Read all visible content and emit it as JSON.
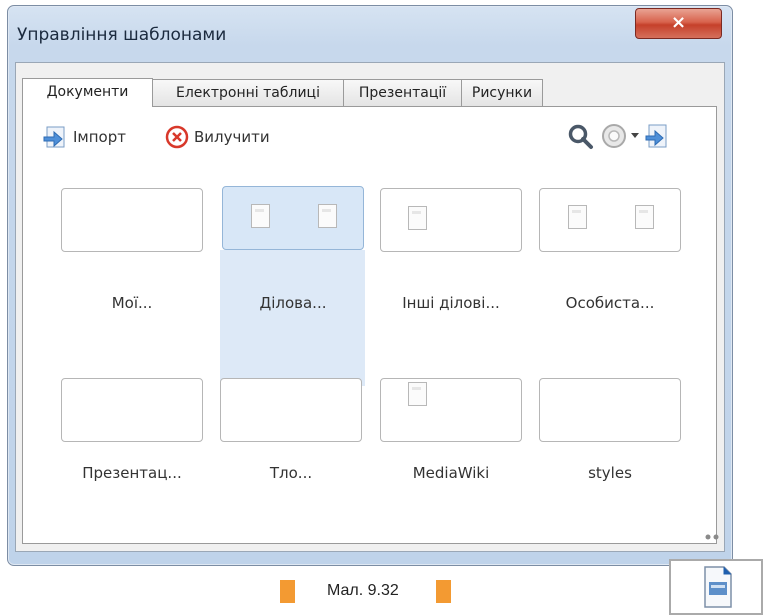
{
  "window": {
    "title": "Управління шаблонами",
    "close_label": "×"
  },
  "tabs": [
    {
      "label": "Документи",
      "active": true
    },
    {
      "label": "Електронні таблиці",
      "active": false
    },
    {
      "label": "Презентації",
      "active": false
    },
    {
      "label": "Рисунки",
      "active": false
    }
  ],
  "toolbar": {
    "import_label": "Імпорт",
    "delete_label": "Вилучити",
    "icons": [
      "import-icon",
      "delete-icon",
      "search-icon",
      "settings-icon",
      "dropdown-arrow-icon",
      "export-icon"
    ]
  },
  "folders": [
    {
      "label": "Мої..."
    },
    {
      "label": "Ділова...",
      "selected": true
    },
    {
      "label": "Інші ділові..."
    },
    {
      "label": "Особиста..."
    },
    {
      "label": "Презентац..."
    },
    {
      "label": "Тло..."
    },
    {
      "label": "MediaWiki"
    },
    {
      "label": "styles"
    }
  ],
  "caption": "Мал. 9.32",
  "colors": {
    "accent": "#f39a32",
    "selection": "#d8e7f7",
    "close": "#c5402a"
  }
}
